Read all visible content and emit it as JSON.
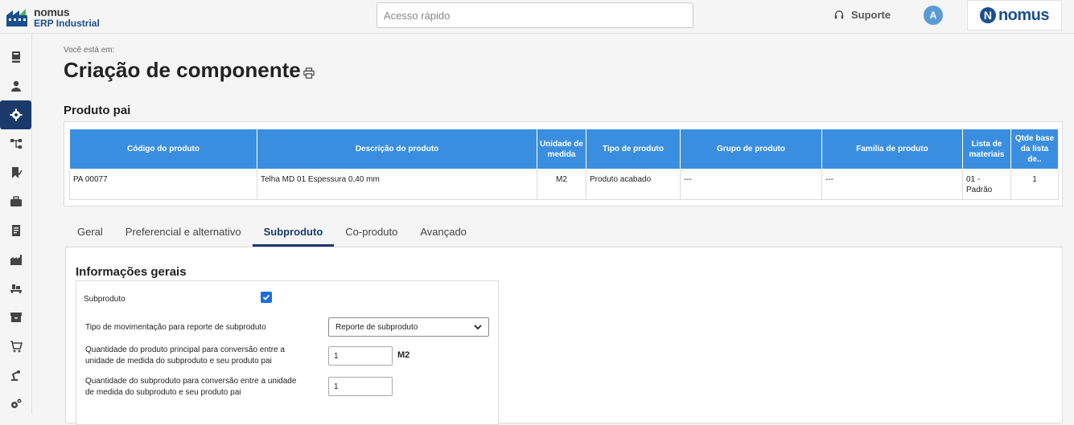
{
  "header": {
    "logo_line1": "nomus",
    "logo_line2": "ERP Industrial",
    "search_placeholder": "Acesso rápido",
    "support_label": "Suporte",
    "avatar_initial": "A",
    "brand_letter": "N",
    "brand_word": "nomus"
  },
  "sidebar": {
    "items": [
      {
        "icon": "book-icon"
      },
      {
        "icon": "user-icon"
      },
      {
        "icon": "gear-icon",
        "active": true
      },
      {
        "icon": "hierarchy-icon"
      },
      {
        "icon": "bookmark-check-icon"
      },
      {
        "icon": "briefcase-icon"
      },
      {
        "icon": "document-icon"
      },
      {
        "icon": "factory-icon"
      },
      {
        "icon": "pallet-icon"
      },
      {
        "icon": "archive-icon"
      },
      {
        "icon": "cart-icon"
      },
      {
        "icon": "robot-arm-icon"
      },
      {
        "icon": "settings-cogs-icon"
      }
    ]
  },
  "breadcrumb": "Você está em:",
  "page_title": "Criação de componente",
  "section_title": "Produto pai",
  "product_table": {
    "headers": [
      "Código do produto",
      "Descrição do produto",
      "Unidade de medida",
      "Tipo de produto",
      "Grupo de produto",
      "Familia de produto",
      "Lista de materiais",
      "Qtde base da lista de.."
    ],
    "rows": [
      [
        "PA 00077",
        "Telha MD 01 Espessura 0,40 mm",
        "M2",
        "Produto acabado",
        "---",
        "---",
        "01 - Padrão",
        "1"
      ]
    ]
  },
  "tabs": [
    {
      "label": "Geral"
    },
    {
      "label": "Preferencial e alternativo"
    },
    {
      "label": "Subproduto",
      "active": true
    },
    {
      "label": "Co-produto"
    },
    {
      "label": "Avançado"
    }
  ],
  "form": {
    "title": "Informações gerais",
    "subproduto_label": "Subproduto",
    "subproduto_checked": true,
    "tipo_label": "Tipo de movimentação para reporte de subproduto",
    "tipo_value": "Reporte de subproduto",
    "qtd_principal_label_1": "Quantidade do produto principal para conversão entre a",
    "qtd_principal_label_2": "unidade de medida do subproduto e seu produto pai",
    "qtd_principal_value": "1",
    "qtd_principal_unit": "M2",
    "qtd_sub_label_1": "Quantidade do subproduto para conversão entre a unidade",
    "qtd_sub_label_2": "de medida do subproduto e seu produto pai",
    "qtd_sub_value": "1"
  }
}
